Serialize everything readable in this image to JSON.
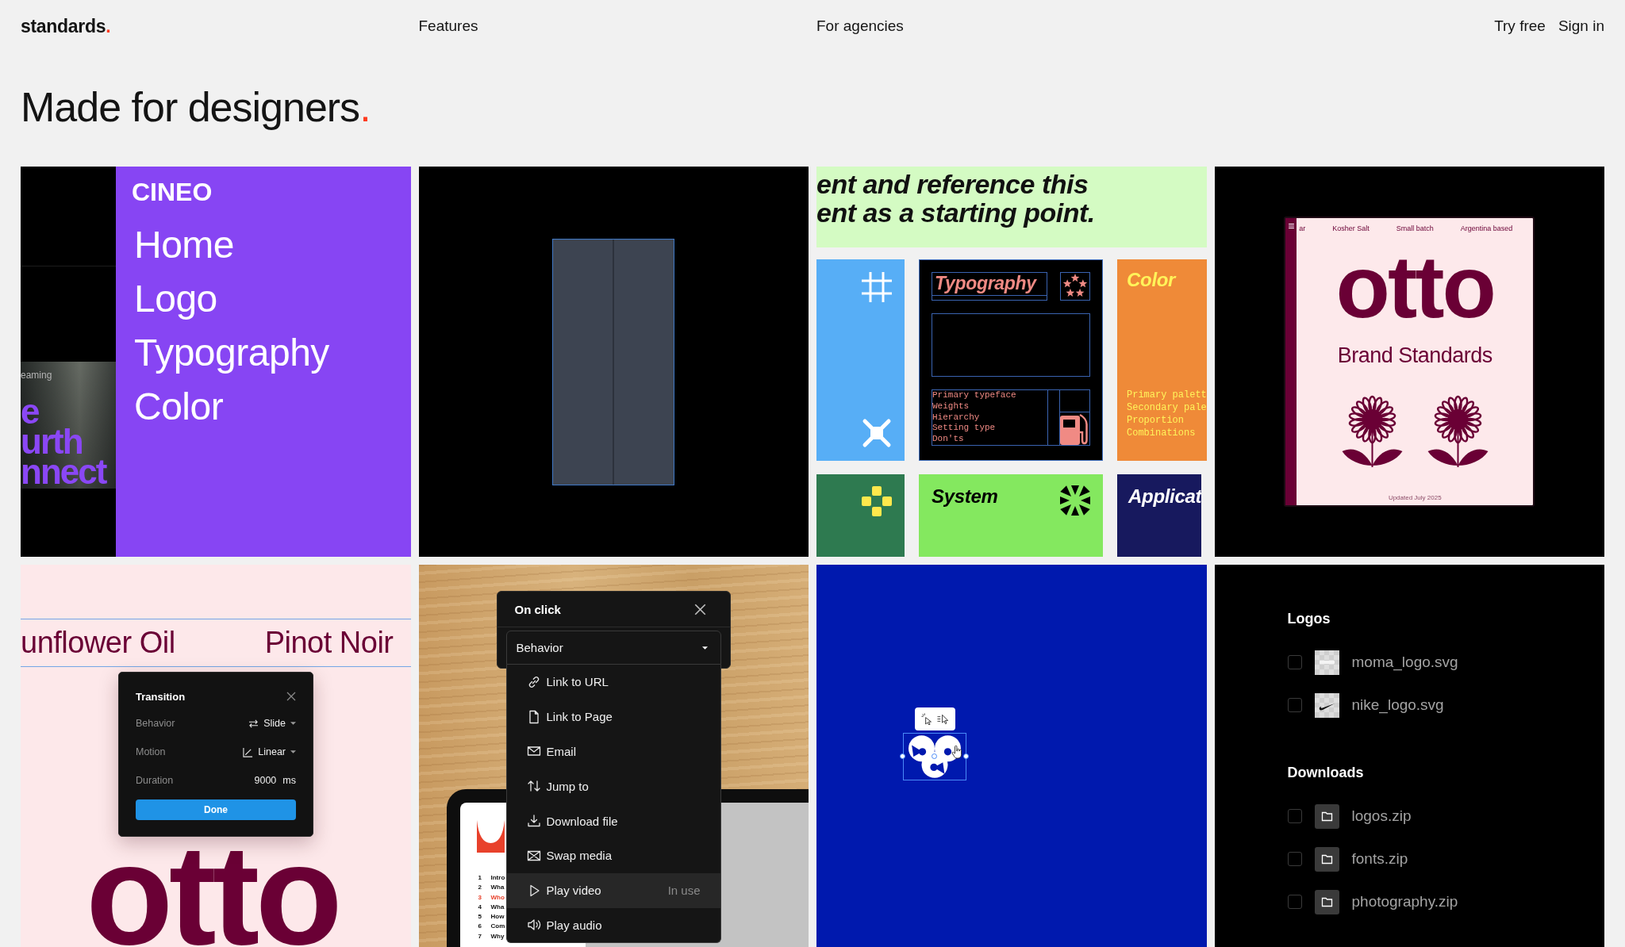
{
  "header": {
    "logo": {
      "text": "standards",
      "accent": "."
    },
    "nav": [
      "Features",
      "For agencies"
    ],
    "actions": [
      "Try free",
      "Sign in"
    ]
  },
  "heading": {
    "text": "Made for designers",
    "accent": "."
  },
  "tiles": [
    {
      "kind": "site",
      "photo": {
        "caption": "eaming",
        "headline": [
          "e",
          "urth",
          "nnect"
        ]
      },
      "brand": "CINEO",
      "menu": [
        "Home",
        "Logo",
        "Typography",
        "Color"
      ]
    },
    {
      "kind": "frame"
    },
    {
      "kind": "mosaic",
      "banner": [
        "ent and reference this",
        "ent as a starting point."
      ],
      "cards": [
        {
          "kind": "symbols"
        },
        {
          "kind": "guides",
          "title": "Typography",
          "items": [
            "Primary typeface",
            "Weights",
            "Hierarchy",
            "Setting type",
            "Don'ts"
          ]
        },
        {
          "kind": "list",
          "title": "Color",
          "items": [
            "Primary palett",
            "Secondary pale",
            "Proportion",
            "Combinations"
          ]
        },
        {
          "kind": "dots"
        },
        {
          "kind": "emblem",
          "title": "System"
        },
        {
          "kind": "title",
          "title": "Applicat"
        }
      ]
    },
    {
      "kind": "cover",
      "tags": [
        "ar",
        "Kosher Salt",
        "Small batch",
        "Argentina based"
      ],
      "title": "otto",
      "subtitle": "Brand Standards",
      "note": "Updated July 2025"
    },
    {
      "kind": "transition",
      "labels": [
        "unflower Oil",
        "Pinot Noir"
      ],
      "backdrop": "otto",
      "dialog": {
        "title": "Transition",
        "fields": [
          {
            "kind": "select",
            "label": "Behavior",
            "value": "Slide"
          },
          {
            "kind": "select",
            "label": "Motion",
            "value": "Linear"
          },
          {
            "kind": "number",
            "label": "Duration",
            "value": "9000",
            "unit": "ms"
          }
        ],
        "button": "Done"
      }
    },
    {
      "kind": "menu",
      "document": [
        {
          "number": "1",
          "text": "Intro",
          "selected": false
        },
        {
          "number": "2",
          "text": "Wha",
          "selected": false
        },
        {
          "number": "3",
          "text": "Who",
          "selected": true
        },
        {
          "number": "4",
          "text": "Wha",
          "selected": false
        },
        {
          "number": "5",
          "text": "How",
          "selected": false
        },
        {
          "number": "6",
          "text": "Com",
          "selected": false
        },
        {
          "number": "7",
          "text": "Why",
          "selected": false
        }
      ],
      "panel": {
        "title": "On click",
        "select": {
          "value": "Behavior",
          "expanded": true
        },
        "options": [
          {
            "label": "Link to URL",
            "selected": false
          },
          {
            "label": "Link to Page",
            "selected": false
          },
          {
            "label": "Email",
            "selected": false
          },
          {
            "label": "Jump to",
            "selected": false
          },
          {
            "label": "Download file",
            "selected": false
          },
          {
            "label": "Swap media",
            "selected": false
          },
          {
            "label": "Play video",
            "selected": true,
            "note": "In use"
          },
          {
            "label": "Play audio",
            "selected": false
          }
        ]
      }
    },
    {
      "kind": "canvas"
    },
    {
      "kind": "files",
      "groups": [
        {
          "title": "Logos",
          "files": [
            {
              "kind": "wordmark",
              "name": "moma_logo.svg",
              "checked": false
            },
            {
              "kind": "symbol",
              "name": "nike_logo.svg",
              "checked": false
            }
          ]
        },
        {
          "title": "Downloads",
          "files": [
            {
              "kind": "folder",
              "name": "logos.zip",
              "checked": false
            },
            {
              "kind": "folder",
              "name": "fonts.zip",
              "checked": false
            },
            {
              "kind": "folder",
              "name": "photography.zip",
              "checked": false
            }
          ]
        }
      ]
    }
  ]
}
